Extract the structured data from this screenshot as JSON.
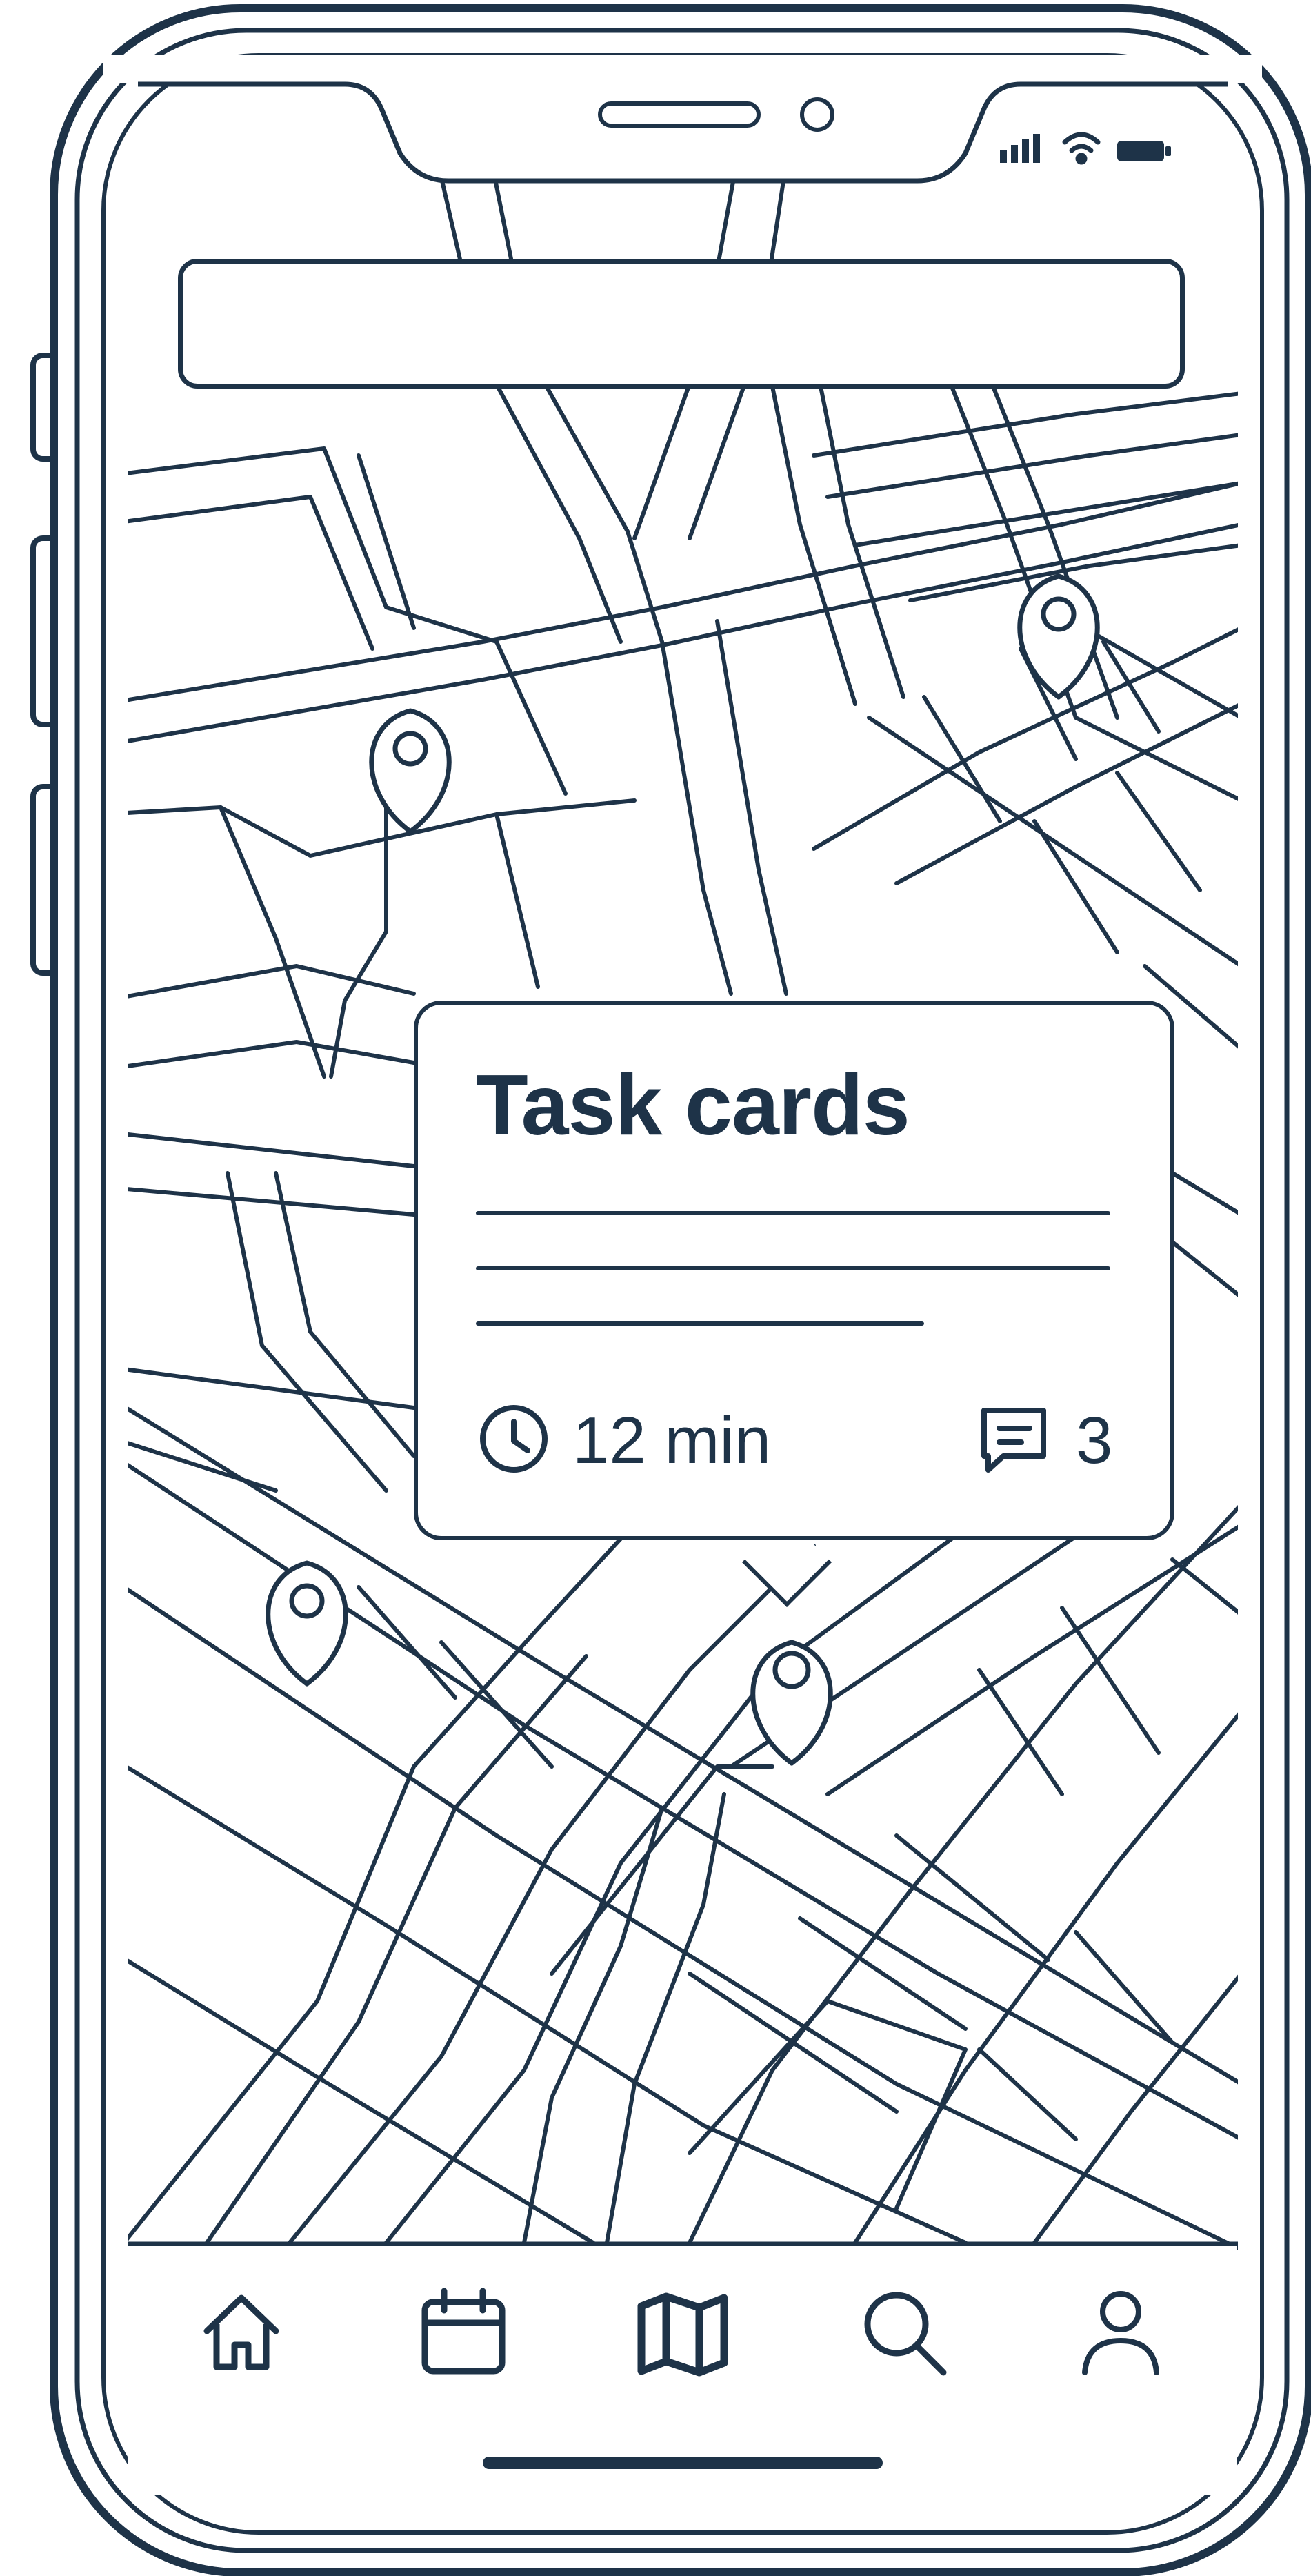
{
  "status_bar": {
    "icons": [
      "signal-icon",
      "wifi-icon",
      "battery-icon"
    ]
  },
  "search": {
    "value": "",
    "placeholder": ""
  },
  "map": {
    "markers": 4
  },
  "task_card": {
    "title": "Task cards",
    "duration": "12 min",
    "comment_count": "3",
    "icons": [
      "clock-icon",
      "comment-icon"
    ]
  },
  "tab_bar": {
    "items": [
      "home-icon",
      "calendar-icon",
      "map-icon",
      "search-icon",
      "profile-icon"
    ]
  },
  "colors": {
    "ink": "#1e3348",
    "background": "#ffffff"
  }
}
